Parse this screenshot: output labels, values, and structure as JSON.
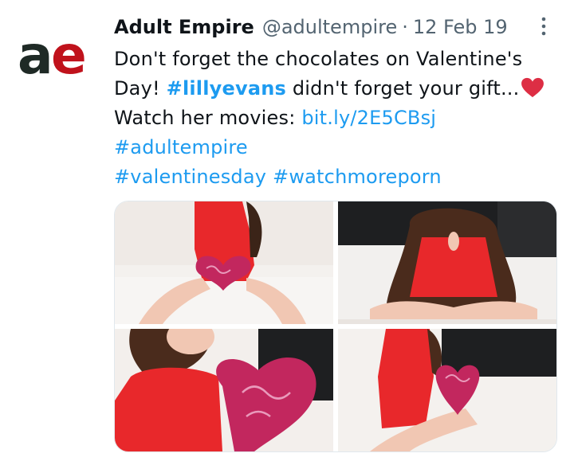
{
  "tweet": {
    "author_name": "Adult Empire",
    "handle": "@adultempire",
    "separator": "·",
    "date": "12 Feb 19",
    "avatar_text": "ae",
    "text_line1": "Don't forget the chocolates on Valentine's",
    "text_line2_pre": "Day! ",
    "hashtag1": "#lillyevans",
    "text_line2_post": "  didn't forget your gift...",
    "text_line3_pre": "Watch her movies: ",
    "link": "bit.ly/2E5CBsj",
    "hashtag2": "#adultempire",
    "hashtag3": "#valentinesday",
    "hashtag4": "#watchmoreporn",
    "heart_icon": "red-heart-emoji",
    "more_icon": "vertical-dots-icon"
  },
  "colors": {
    "link": "#1d9bf0",
    "secondary_text": "#536471",
    "avatar_dark": "#1f2a26",
    "avatar_red": "#c0121c",
    "dress_red": "#e8282b",
    "heart_box": "#c2275e"
  },
  "media": {
    "photo_count": 4
  }
}
